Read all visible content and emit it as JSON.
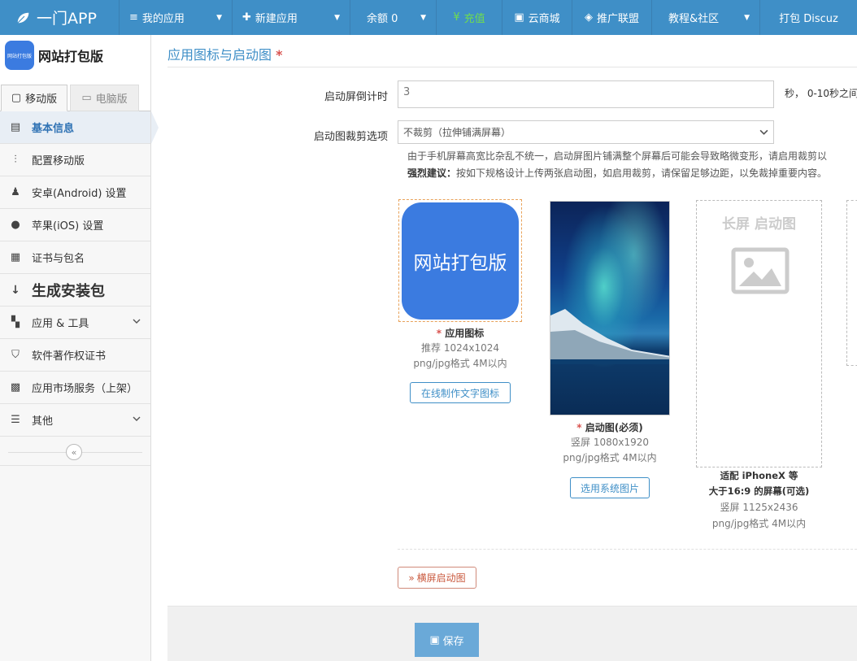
{
  "topnav": {
    "brand": "一门APP",
    "items": [
      {
        "label": "我的应用",
        "glyph": "≡",
        "caret": true
      },
      {
        "label": "新建应用",
        "glyph": "✚",
        "caret": true
      },
      {
        "label": "余额 0",
        "glyph": "",
        "caret": true
      },
      {
        "label": "充值",
        "glyph": "¥",
        "caret": false
      },
      {
        "label": "云商城",
        "glyph": "▣",
        "caret": false
      },
      {
        "label": "推广联盟",
        "glyph": "◈",
        "caret": false
      },
      {
        "label": "教程&社区",
        "glyph": "",
        "caret": true
      },
      {
        "label": "打包 Discuz",
        "glyph": "",
        "caret": false
      }
    ]
  },
  "sidebar": {
    "app_logo_text": "网站打包版",
    "app_name": "网站打包版",
    "tab_mobile": "移动版",
    "tab_pc": "电脑版",
    "items": [
      {
        "label": "基本信息",
        "icon": "document-list-icon"
      },
      {
        "label": "配置移动版",
        "icon": "sliders-icon"
      },
      {
        "label": "安卓(Android) 设置",
        "icon": "android-icon"
      },
      {
        "label": "苹果(iOS) 设置",
        "icon": "apple-icon"
      },
      {
        "label": "证书与包名",
        "icon": "certificate-icon"
      },
      {
        "label": "生成安装包",
        "icon": "sort-numeric-icon"
      },
      {
        "label": "应用 & 工具",
        "icon": "grid-icon"
      },
      {
        "label": "软件著作权证书",
        "icon": "shield-icon"
      },
      {
        "label": "应用市场服务（上架）",
        "icon": "store-icon"
      },
      {
        "label": "其他",
        "icon": "menu-lines-icon"
      }
    ]
  },
  "main": {
    "title": "应用图标与启动图",
    "countdown_label": "启动屏倒计时",
    "countdown_value": "3",
    "countdown_hint": "秒， 0-10秒之间",
    "crop_label": "启动图裁剪选项",
    "crop_selected": "不裁剪（拉伸铺满屏幕）",
    "desc_line1": "由于手机屏幕高宽比杂乱不统一，启动屏图片铺满整个屏幕后可能会导致略微变形，请启用裁剪以",
    "desc_line2_bold": "强烈建议：",
    "desc_line2": "按如下规格设计上传两张启动图，如启用裁剪，请保留足够边距，以免裁掉重要内容。",
    "icon_card": {
      "tile_text": "网站打包版",
      "caption": "应用图标",
      "size": "推荐 1024x1024",
      "format": "png/jpg格式 4M以内",
      "button": "在线制作文字图标"
    },
    "splash_card": {
      "caption": "启动图(必须)",
      "size": "竖屏 1080x1920",
      "format": "png/jpg格式 4M以内",
      "button": "选用系统图片"
    },
    "long_card": {
      "frame_title": "长屏 启动图",
      "caption1": "适配 iPhoneX 等",
      "caption2": "大于16:9 的屏幕(可选)",
      "size": "竖屏 1125x2436",
      "format": "png/jpg格式 4M以内"
    },
    "landscape_button": "横屏启动图",
    "save_button": "保存"
  }
}
